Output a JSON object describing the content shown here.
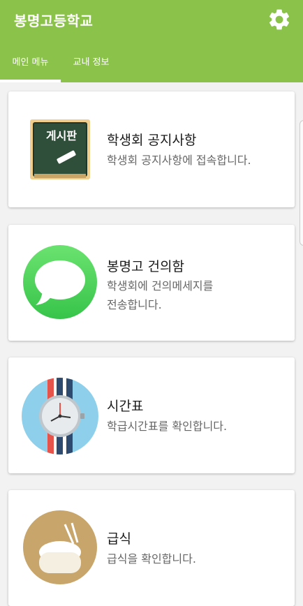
{
  "app": {
    "title": "봉명고등학교"
  },
  "tabs": [
    {
      "label": "메인 메뉴",
      "selected": true
    },
    {
      "label": "교내 정보",
      "selected": false
    }
  ],
  "board_icon_text": "게시판",
  "cards": [
    {
      "title": "학생회 공지사항",
      "desc": "학생회 공지사항에 접속합니다.",
      "icon": "chalkboard-icon"
    },
    {
      "title": "봉명고 건의함",
      "desc_lines": [
        "학생회에 건의메세지를",
        "전송합니다."
      ],
      "icon": "message-bubble-icon"
    },
    {
      "title": "시간표",
      "desc": "학급시간표를 확인합니다.",
      "icon": "watch-icon"
    },
    {
      "title": "급식",
      "desc": "급식을 확인합니다.",
      "icon": "rice-bowl-icon"
    }
  ],
  "colors": {
    "appbar": "#8bc34a",
    "accent": "#ffffff"
  }
}
